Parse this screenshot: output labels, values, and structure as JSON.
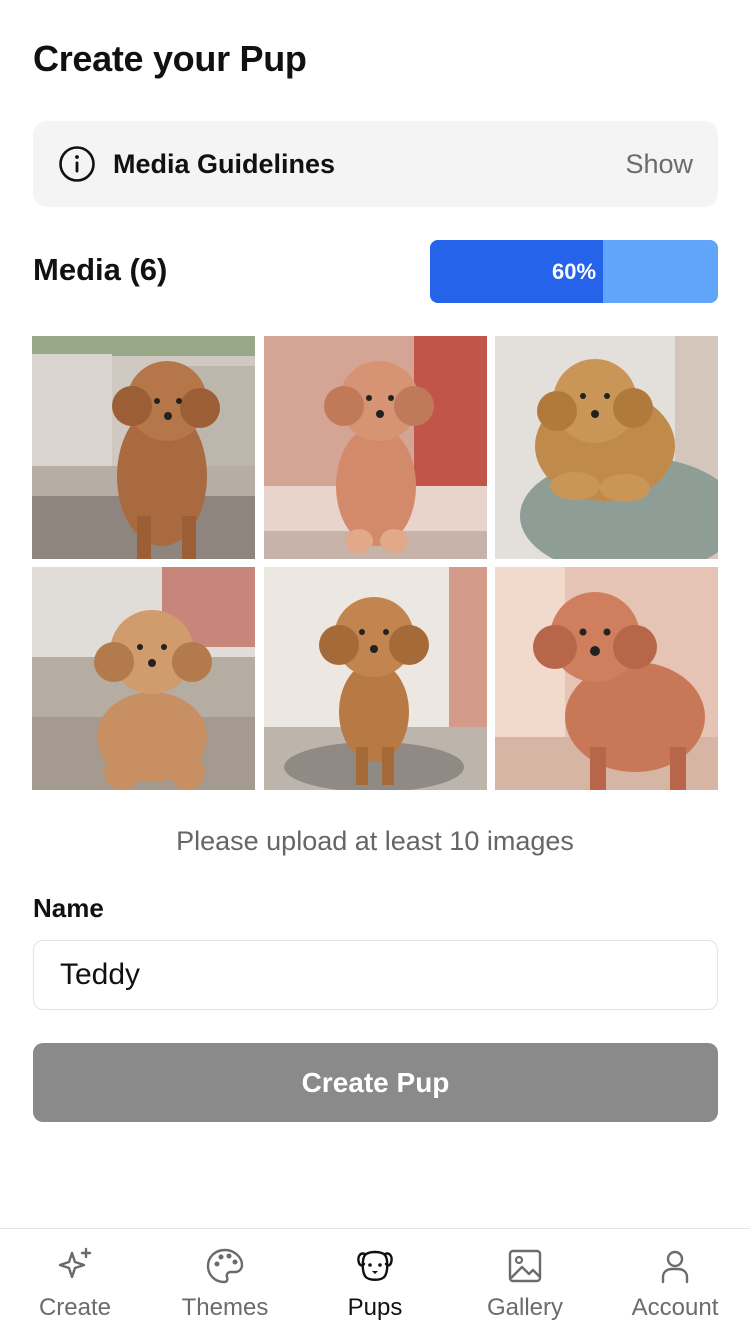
{
  "header": {
    "title": "Create your Pup"
  },
  "guidelines": {
    "label": "Media Guidelines",
    "toggle_label": "Show",
    "icon": "info-icon"
  },
  "media": {
    "heading": "Media (6)",
    "progress_percent": 60,
    "progress_text": "60%",
    "progress_color": "#2563eb",
    "progress_track_color": "#60a5fa",
    "photos": [
      "poodle-photo-1",
      "poodle-photo-2",
      "poodle-photo-3",
      "poodle-photo-4",
      "poodle-photo-5",
      "poodle-photo-6"
    ]
  },
  "hint": "Please upload at least 10 images",
  "form": {
    "name_label": "Name",
    "name_value": "Teddy",
    "submit_label": "Create Pup",
    "submit_color": "#8a8a8a"
  },
  "tabbar": {
    "active": "Pups",
    "items": [
      {
        "label": "Create",
        "icon": "sparkles-icon"
      },
      {
        "label": "Themes",
        "icon": "palette-icon"
      },
      {
        "label": "Pups",
        "icon": "dog-icon"
      },
      {
        "label": "Gallery",
        "icon": "image-icon"
      },
      {
        "label": "Account",
        "icon": "user-icon"
      }
    ]
  }
}
